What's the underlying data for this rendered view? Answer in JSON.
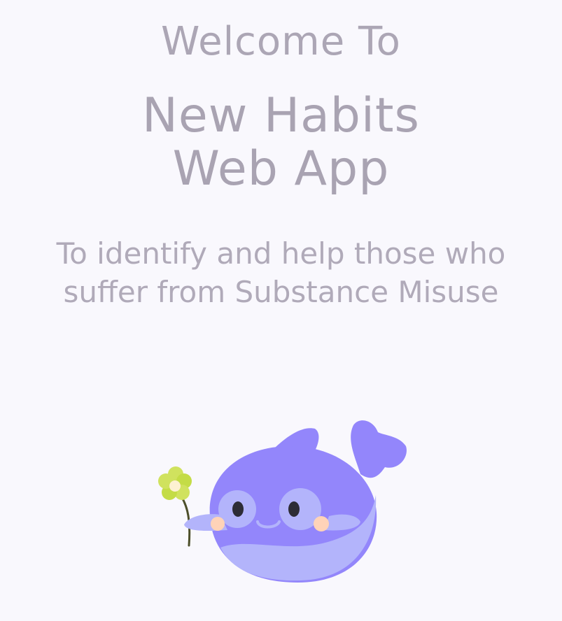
{
  "welcome": {
    "heading": "Welcome To",
    "title_line1": "New Habits",
    "title_line2": "Web App",
    "mission": "To identify and help those who suffer from Substance Misuse"
  },
  "mascot": {
    "icon": "whale-mascot-icon",
    "flower_icon": "flower-icon",
    "colors": {
      "body": "#9386fb",
      "belly": "#b3b4fb",
      "eye_patch": "#b3b4fb",
      "cheek": "#ffd3b8",
      "flower_petal": "#d0e25e",
      "flower_center": "#fdf1d2",
      "stem": "#4d4f2a"
    }
  },
  "colors": {
    "background": "#f9f8fd",
    "text": "#aca6b5"
  }
}
